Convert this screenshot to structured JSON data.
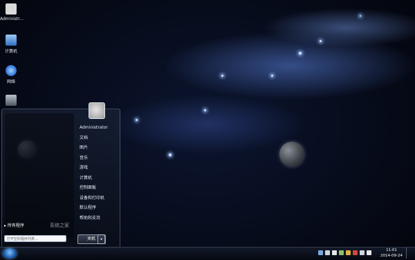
{
  "desktop": {
    "icons": [
      {
        "label": "Administr...",
        "icon": "user-folder-icon",
        "color": "#d9d9d9"
      },
      {
        "label": "计算机",
        "icon": "computer-icon",
        "color": "#6fa8e8"
      },
      {
        "label": "网络",
        "icon": "network-globe-icon",
        "color": "#3b7ddd"
      },
      {
        "label": "",
        "icon": "recycle-bin-icon",
        "color": "#7d8794"
      }
    ]
  },
  "start_menu": {
    "user_name": "Administrator",
    "right_items": [
      "文档",
      "图片",
      "音乐",
      "游戏",
      "计算机",
      "控制面板",
      "设备和打印机",
      "默认程序",
      "帮助和支持"
    ],
    "all_programs": "所有程序",
    "search_placeholder": "打开空的程序列表...",
    "shutdown_label": "关机",
    "watermark": "系统之家"
  },
  "taskbar": {
    "time": "11:01",
    "date": "2014-09-24",
    "tray_icons": [
      "notify-icon",
      "security-icon",
      "network-tray-icon",
      "speaker-icon",
      "battery-icon",
      "flag-icon",
      "chat-icon",
      "input-icon"
    ]
  },
  "colors": {
    "background": "#050914",
    "accent": "#3b7ddd"
  }
}
